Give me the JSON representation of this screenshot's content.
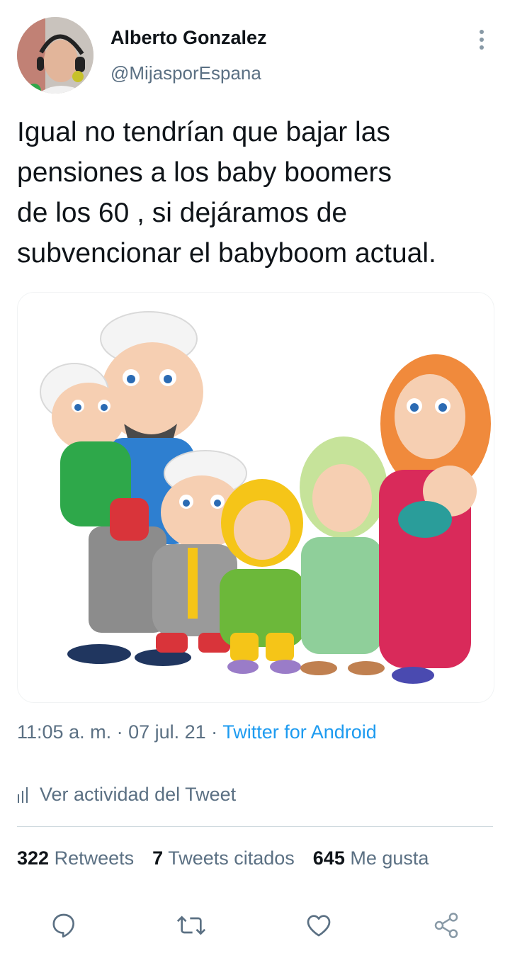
{
  "author": {
    "name": "Alberto Gonzalez",
    "handle": "@MijasporEspana"
  },
  "tweet": {
    "lines": [
      "Igual no tendrían que bajar las",
      "pensiones a los baby boomers",
      "de los 60 , si dejáramos de",
      "subvencionar el babyboom actual."
    ]
  },
  "meta": {
    "time": "11:05 a. m.",
    "sep1": " · ",
    "date": "07 jul. 21",
    "sep2": " · ",
    "source": "Twitter for Android"
  },
  "activity_label": "Ver actividad del Tweet",
  "stats": {
    "retweets_count": "322",
    "retweets_label": "Retweets",
    "quotes_count": "7",
    "quotes_label": "Tweets citados",
    "likes_count": "645",
    "likes_label": "Me gusta"
  },
  "colors": {
    "accent": "#1d9bf0",
    "secondary_text": "#5b7083",
    "primary_text": "#0f1419"
  },
  "icons": [
    "more-vertical-icon",
    "analytics-icon",
    "reply-icon",
    "retweet-icon",
    "like-icon",
    "share-icon"
  ]
}
